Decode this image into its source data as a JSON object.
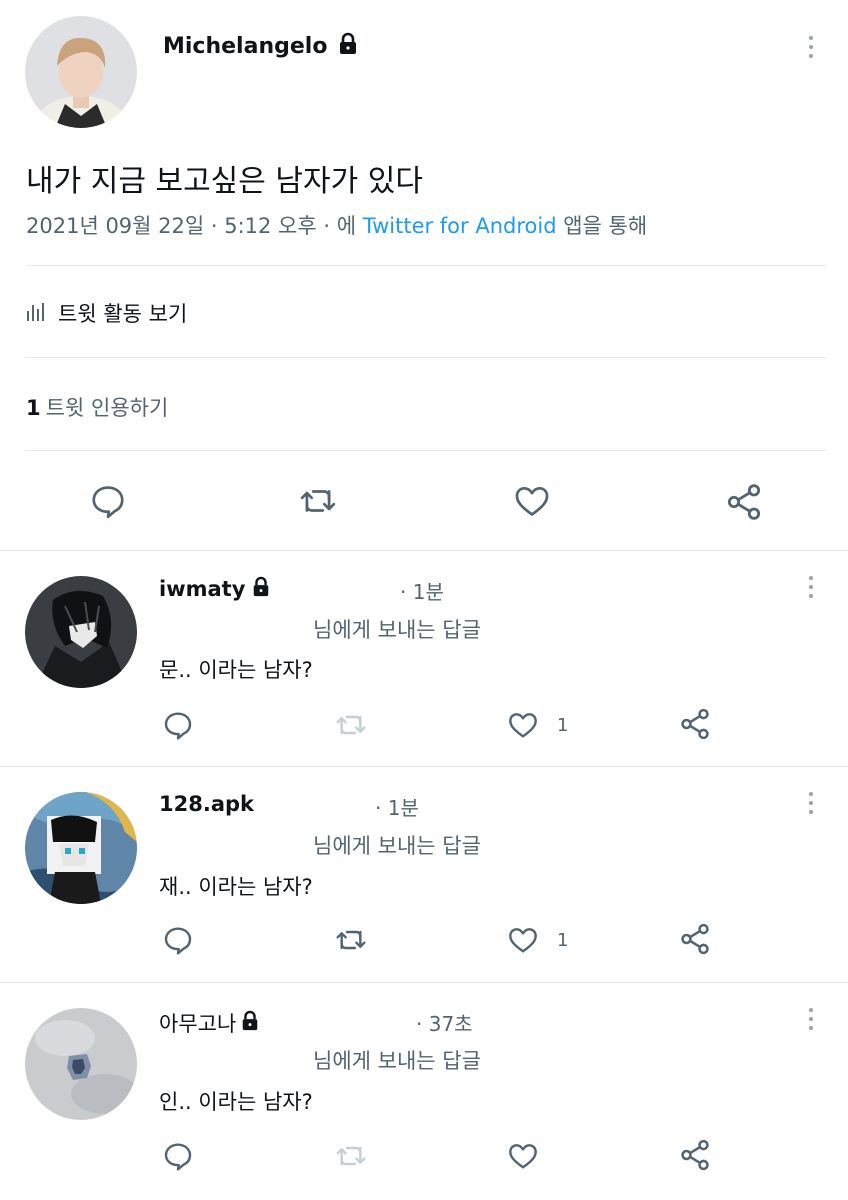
{
  "tweet": {
    "author": "Michelangelo",
    "text": "내가 지금 보고싶은 남자가 있다",
    "date_time": "2021년 09월 22일 · 5:12 오후 · 에",
    "client": "Twitter for Android",
    "client_suffix": "앱을 통해",
    "activity_label": "트윗 활동 보기",
    "quote_count": "1",
    "quote_label": "트윗 인용하기"
  },
  "replies": [
    {
      "name": "iwmaty",
      "locked": true,
      "time": "· 1분",
      "reply_to": "님에게 보내는 답글",
      "text": "문.. 이라는 남자?",
      "like_count": "1"
    },
    {
      "name": "128.apk",
      "locked": false,
      "time": "· 1분",
      "reply_to": "님에게 보내는 답글",
      "text": "재.. 이라는 남자?",
      "like_count": "1"
    },
    {
      "name": "아무고나",
      "locked": true,
      "time": "· 37초",
      "reply_to": "님에게 보내는 답글",
      "text": "인.. 이라는 남자?",
      "like_count": ""
    }
  ],
  "colors": {
    "link": "#1d9bf0",
    "text": "#0f1419",
    "muted": "#536471",
    "divider": "#e6e9eb"
  },
  "icons": [
    "lock-icon",
    "more-icon",
    "reply-icon",
    "retweet-icon",
    "like-icon",
    "share-icon",
    "activity-icon"
  ]
}
